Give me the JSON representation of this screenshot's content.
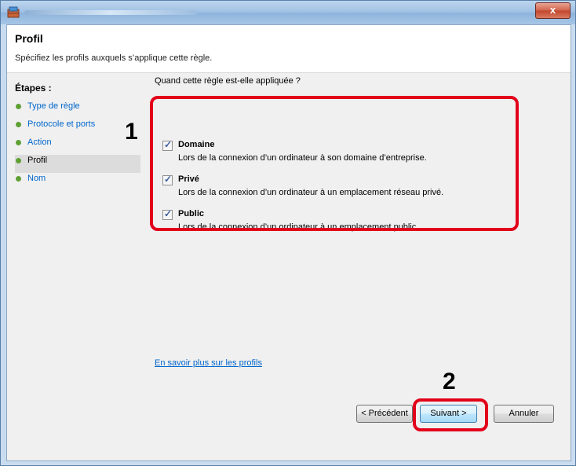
{
  "header": {
    "title": "Profil",
    "subtitle": "Spécifiez les profils auxquels s’applique cette règle."
  },
  "steps": {
    "title": "Étapes :",
    "items": [
      "Type de règle",
      "Protocole et ports",
      "Action",
      "Profil",
      "Nom"
    ],
    "current": "Profil"
  },
  "main": {
    "question": "Quand cette règle est-elle appliquée ?",
    "options": [
      {
        "label": "Domaine",
        "description": "Lors de la connexion d’un ordinateur à son domaine d’entreprise.",
        "checked": true
      },
      {
        "label": "Privé",
        "description": "Lors de la connexion d’un ordinateur à un emplacement réseau privé.",
        "checked": true
      },
      {
        "label": "Public",
        "description": "Lors de la connexion d’un ordinateur à un emplacement public.",
        "checked": true
      }
    ],
    "learn_more": "En savoir plus sur les profils"
  },
  "buttons": {
    "back": "< Précédent",
    "next": "Suivant >",
    "cancel": "Annuler"
  },
  "titlebar": {
    "close": "x"
  },
  "annotations": {
    "marker1": "1",
    "marker2": "2"
  },
  "colors": {
    "highlight": "#e2001a",
    "link": "#0066cc",
    "step_bullet": "#5fa035"
  }
}
